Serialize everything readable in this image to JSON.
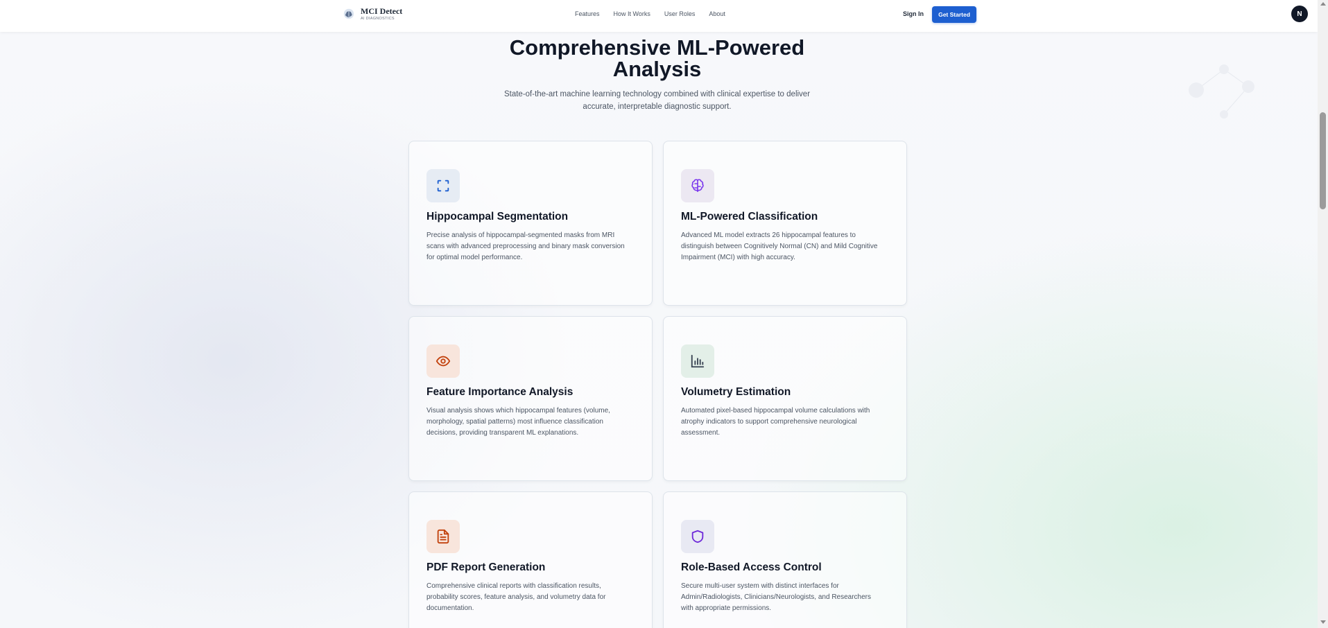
{
  "nav": {
    "brand_title": "MCI Detect",
    "brand_subtitle": "AI DIAGNOSTICS",
    "links": [
      "Features",
      "How It Works",
      "User Roles",
      "About"
    ],
    "signin": "Sign In",
    "get_started": "Get Started",
    "avatar_initial": "N"
  },
  "hero": {
    "title_line1": "Comprehensive ML-Powered",
    "title_line2": "Analysis",
    "subtitle_line1": "State-of-the-art machine learning technology combined with clinical expertise to deliver",
    "subtitle_line2": "accurate, interpretable diagnostic support."
  },
  "features": [
    {
      "icon": "scan-focus-icon",
      "color": "#1d5fd0",
      "title": "Hippocampal Segmentation",
      "desc_lines": [
        "Precise analysis of hippocampal-segmented masks from MRI",
        "scans with advanced preprocessing and binary mask conversion",
        "for optimal model performance."
      ]
    },
    {
      "icon": "brain-icon",
      "color": "#7c3aed",
      "title": "ML-Powered Classification",
      "desc_lines": [
        "Advanced ML model extracts 26 hippocampal features to",
        "distinguish between Cognitively Normal (CN) and Mild Cognitive",
        "Impairment (MCI) with high accuracy."
      ]
    },
    {
      "icon": "eye-icon",
      "color": "#c2410c",
      "title": "Feature Importance Analysis",
      "desc_lines": [
        "Visual analysis shows which hippocampal features (volume,",
        "morphology, spatial patterns) most influence classification",
        "decisions, providing transparent ML explanations."
      ]
    },
    {
      "icon": "bar-chart-icon",
      "color": "#374151",
      "title": "Volumetry Estimation",
      "desc_lines": [
        "Automated pixel-based hippocampal volume calculations with",
        "atrophy indicators to support comprehensive neurological",
        "assessment."
      ]
    },
    {
      "icon": "file-text-icon",
      "color": "#c2410c",
      "title": "PDF Report Generation",
      "desc_lines": [
        "Comprehensive clinical reports with classification results,",
        "probability scores, feature analysis, and volumetry data for",
        "documentation."
      ]
    },
    {
      "icon": "shield-icon",
      "color": "#6d28d9",
      "title": "Role-Based Access Control",
      "desc_lines": [
        "Secure multi-user system with distinct interfaces for",
        "Admin/Radiologists, Clinicians/Neurologists, and Researchers",
        "with appropriate permissions."
      ]
    }
  ]
}
